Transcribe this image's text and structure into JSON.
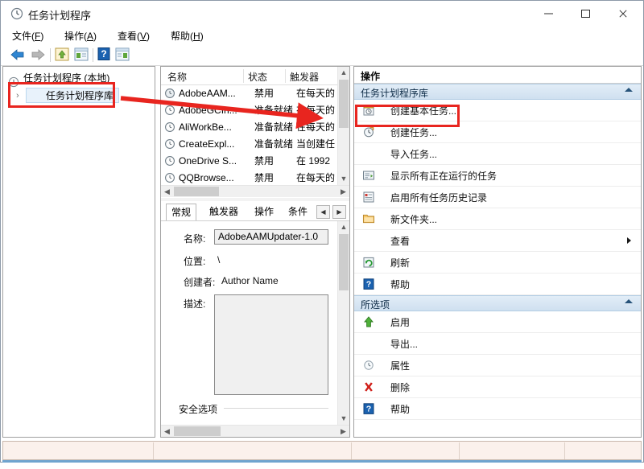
{
  "window": {
    "title": "任务计划程序",
    "title_icon": "clock-icon",
    "minimize_label": "最小化",
    "maximize_label": "最大化",
    "close_label": "关闭"
  },
  "menu": [
    {
      "label": "文件(F)",
      "text": "文件",
      "accel": "F"
    },
    {
      "label": "操作(A)",
      "text": "操作",
      "accel": "A"
    },
    {
      "label": "查看(V)",
      "text": "查看",
      "accel": "V"
    },
    {
      "label": "帮助(H)",
      "text": "帮助",
      "accel": "H"
    }
  ],
  "toolbar": [
    {
      "name": "back-icon"
    },
    {
      "name": "forward-icon"
    },
    {
      "name": "up-folder-icon"
    },
    {
      "name": "show-console-tree-icon"
    },
    {
      "name": "help-icon"
    },
    {
      "name": "show-action-pane-icon"
    }
  ],
  "tree": {
    "root": {
      "label": "任务计划程序 (本地)",
      "icon": "clock-icon"
    },
    "child": {
      "label": "任务计划程序库",
      "icon": "folder-clock-icon",
      "expander": "›",
      "selected": true,
      "highlighted": true
    }
  },
  "task_list": {
    "columns": [
      "名称",
      "状态",
      "触发器"
    ],
    "rows": [
      {
        "name": "AdobeAAM...",
        "status": "禁用",
        "trigger": "在每天的"
      },
      {
        "name": "AdobeGCIn...",
        "status": "准备就绪",
        "trigger": "在每天的"
      },
      {
        "name": "AliWorkBe...",
        "status": "准备就绪",
        "trigger": "在每天的"
      },
      {
        "name": "CreateExpl...",
        "status": "准备就绪",
        "trigger": "当创建任"
      },
      {
        "name": "OneDrive S...",
        "status": "禁用",
        "trigger": "在 1992"
      },
      {
        "name": "QQBrowse...",
        "status": "禁用",
        "trigger": "在每天的"
      }
    ]
  },
  "details": {
    "tabs": [
      {
        "label": "常规",
        "active": true
      },
      {
        "label": "触发器",
        "active": false
      },
      {
        "label": "操作",
        "active": false
      },
      {
        "label": "条件",
        "active": false
      }
    ],
    "tab_nav_prev": "◀",
    "tab_nav_next": "▶",
    "fields": [
      {
        "label": "名称:",
        "value": "AdobeAAMUpdater-1.0",
        "type": "textbox"
      },
      {
        "label": "位置:",
        "value": "\\",
        "type": "text"
      },
      {
        "label": "创建者:",
        "value": "Author Name",
        "type": "text"
      },
      {
        "label": "描述:",
        "value": "",
        "type": "textarea"
      }
    ],
    "section_header": "安全选项"
  },
  "actions": {
    "title": "操作",
    "groups": [
      {
        "label": "任务计划程序库",
        "collapse_icon": "chevron-up-icon",
        "items": [
          {
            "label": "创建基本任务...",
            "icon": "create-basic-task-icon",
            "highlighted": true
          },
          {
            "label": "创建任务...",
            "icon": "create-task-icon",
            "highlighted": false
          },
          {
            "label": "导入任务...",
            "icon": "",
            "highlighted": false
          },
          {
            "label": "显示所有正在运行的任务",
            "icon": "running-tasks-icon",
            "highlighted": false
          },
          {
            "label": "启用所有任务历史记录",
            "icon": "task-history-icon",
            "highlighted": false
          },
          {
            "label": "新文件夹...",
            "icon": "new-folder-icon",
            "highlighted": false
          },
          {
            "label": "查看",
            "icon": "",
            "submenu": true,
            "highlighted": false
          },
          {
            "label": "刷新",
            "icon": "refresh-icon",
            "highlighted": false
          },
          {
            "label": "帮助",
            "icon": "help-icon",
            "highlighted": false
          }
        ]
      },
      {
        "label": "所选项",
        "collapse_icon": "chevron-up-icon",
        "items": [
          {
            "label": "启用",
            "icon": "enable-arrow-icon",
            "highlighted": false
          },
          {
            "label": "导出...",
            "icon": "",
            "highlighted": false
          },
          {
            "label": "属性",
            "icon": "properties-icon",
            "highlighted": false
          },
          {
            "label": "删除",
            "icon": "delete-x-icon",
            "highlighted": false
          },
          {
            "label": "帮助",
            "icon": "help-icon",
            "highlighted": false
          }
        ]
      }
    ]
  },
  "annotations": {
    "accent_color": "#e8251f",
    "boxes": [
      {
        "name": "tree-library-highlight"
      },
      {
        "name": "create-basic-task-highlight"
      }
    ],
    "arrow": {
      "name": "pointer-arrow",
      "from": "任务计划程序库",
      "to": "创建基本任务..."
    }
  }
}
